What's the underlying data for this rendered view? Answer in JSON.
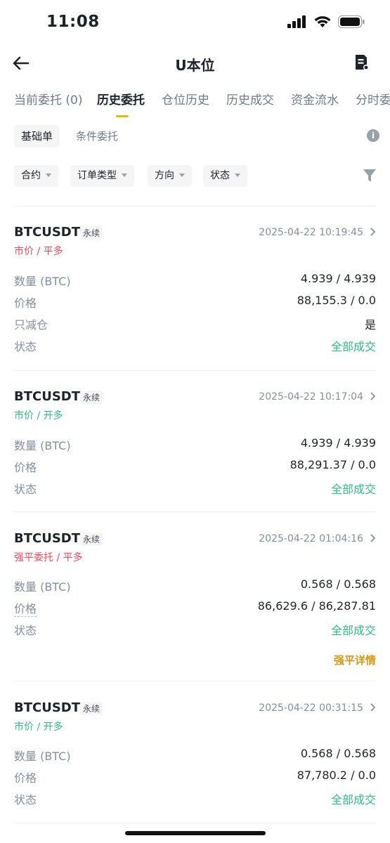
{
  "status_bar": {
    "time": "11:08"
  },
  "nav": {
    "title": "U本位"
  },
  "tabs": [
    {
      "label": "当前委托 (0)"
    },
    {
      "label": "历史委托"
    },
    {
      "label": "仓位历史"
    },
    {
      "label": "历史成交"
    },
    {
      "label": "资金流水"
    },
    {
      "label": "分时委"
    }
  ],
  "subtabs": [
    {
      "label": "基础单"
    },
    {
      "label": "条件委托"
    }
  ],
  "filters": [
    {
      "label": "合约"
    },
    {
      "label": "订单类型"
    },
    {
      "label": "方向"
    },
    {
      "label": "状态"
    }
  ],
  "orders": [
    {
      "symbol": "BTCUSDT",
      "contract": "永续",
      "time": "2025-04-22 10:19:45",
      "order_type": "市价 / 平多",
      "rows": [
        {
          "label": "数量 (BTC)",
          "value": "4.939 / 4.939"
        },
        {
          "label": "价格",
          "value": "88,155.3 / 0.0"
        },
        {
          "label": "只减仓",
          "value": "是"
        },
        {
          "label": "状态",
          "value": "全部成交"
        }
      ]
    },
    {
      "symbol": "BTCUSDT",
      "contract": "永续",
      "time": "2025-04-22 10:17:04",
      "order_type": "市价 / 开多",
      "rows": [
        {
          "label": "数量 (BTC)",
          "value": "4.939 / 4.939"
        },
        {
          "label": "价格",
          "value": "88,291.37 / 0.0"
        },
        {
          "label": "状态",
          "value": "全部成交"
        }
      ]
    },
    {
      "symbol": "BTCUSDT",
      "contract": "永续",
      "time": "2025-04-22 01:04:16",
      "order_type": "强平委托 / 平多",
      "rows": [
        {
          "label": "数量 (BTC)",
          "value": "0.568 / 0.568"
        },
        {
          "label": "价格",
          "value": "86,629.6 / 86,287.81"
        },
        {
          "label": "状态",
          "value": "全部成交"
        }
      ],
      "link": "强平详情"
    },
    {
      "symbol": "BTCUSDT",
      "contract": "永续",
      "time": "2025-04-22 00:31:15",
      "order_type": "市价 / 开多",
      "rows": [
        {
          "label": "数量 (BTC)",
          "value": "0.568 / 0.568"
        },
        {
          "label": "价格",
          "value": "87,780.2 / 0.0"
        },
        {
          "label": "状态",
          "value": "全部成交"
        }
      ]
    }
  ],
  "colors": {
    "accent": "#f0b90b",
    "buy_green": "#2ebd85",
    "sell_red": "#f6465d",
    "link_gold": "#d89614"
  }
}
